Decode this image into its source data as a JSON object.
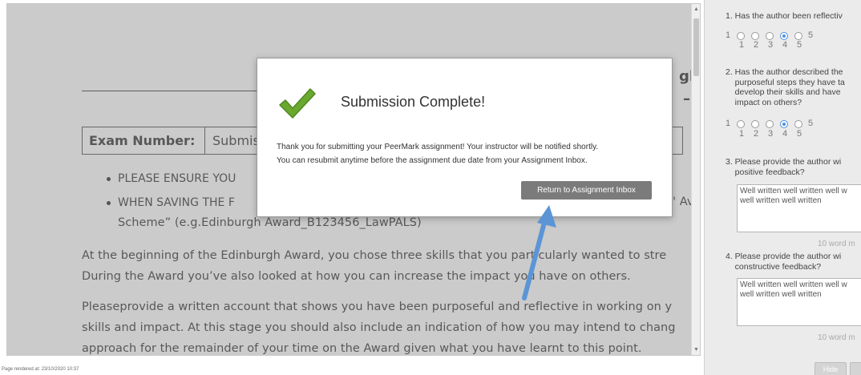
{
  "document": {
    "heading_fragment": "gh",
    "dash": "–",
    "exam_label": "Exam Number:",
    "exam_value_fragment": "Submis",
    "bullets": [
      "PLEASE ENSURE YOU",
      "WHEN SAVING THE F"
    ],
    "bullet_tail": "' Av",
    "bullet_cont": "Scheme” (e.g.Edinburgh Award_B123456_LawPALS)",
    "para1_line1": "At the beginning of the Edinburgh Award, you chose three skills that you particularly wanted to stre",
    "para1_line2": "During the Award you’ve also looked at how you can increase the impact you have on others.",
    "para2_line1": "Pleaseprovide a written account that shows you have been purposeful and reflective in working on y",
    "para2_line2": "skills and impact. At this stage you should also include an indication of how you may intend to chang",
    "para2_line3": "approach for the remainder of your time on the Award given what you have learnt to this point."
  },
  "modal": {
    "title": "Submission Complete!",
    "message_line1": "Thank you for submitting your PeerMark assignment! Your instructor will be notified shortly.",
    "message_line2": "You can resubmit anytime before the assignment due date from your Assignment Inbox.",
    "button_label": "Return to Assignment Inbox",
    "icon": "checkmark-icon",
    "check_color": "#6aa82f"
  },
  "panel": {
    "q1_text": "1. Has the author been reflectiv",
    "q1_scale": [
      "1",
      "2",
      "3",
      "4",
      "5"
    ],
    "q1_end": "5",
    "q1_selected": 4,
    "q2_text": "2. Has the author described the\n    purposeful steps they have ta\n    develop their skills and have\n    impact on others?",
    "q2_end": "5",
    "q2_selected": 4,
    "q3_text": "3. Please provide the author wi\n    positive feedback?",
    "q3_answer": "Well written well written well w\nwell written well written",
    "q3_limit": "10 word m",
    "q4_text": "4. Please provide the author wi\n    constructive feedback?",
    "q4_answer": "Well written well written well w\nwell written well written",
    "q4_limit": "10 word m",
    "hide_label": "Hide"
  },
  "footer_text": "Page rendered at: 23/10/2020 10:37",
  "colors": {
    "arrow": "#5b95d6",
    "radio_selected": "#4a90e2",
    "button_bg": "#7b7b7b"
  }
}
